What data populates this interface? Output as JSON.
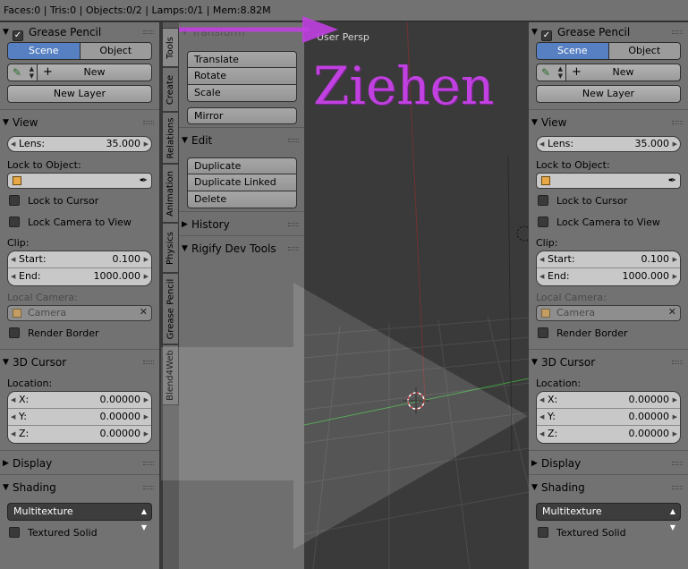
{
  "statusbar": {
    "text": "Faces:0 | Tris:0 | Objects:0/2 | Lamps:0/1 | Mem:8.82M"
  },
  "colors": {
    "accent": "#5680c2",
    "annotation": "#c040e0",
    "x_axis": "#c03030",
    "y_axis": "#40a040"
  },
  "properties": {
    "grease_pencil": {
      "title": "Grease Pencil",
      "scene": "Scene",
      "object": "Object",
      "new": "New",
      "new_layer": "New Layer"
    },
    "view": {
      "title": "View",
      "lens_label": "Lens:",
      "lens_value": "35.000",
      "lock_to_object": "Lock to Object:",
      "lock_to_cursor": "Lock to Cursor",
      "lock_camera": "Lock Camera to View",
      "clip": "Clip:",
      "start_label": "Start:",
      "start_value": "0.100",
      "end_label": "End:",
      "end_value": "1000.000",
      "local_camera": "Local Camera:",
      "camera": "Camera",
      "render_border": "Render Border"
    },
    "cursor": {
      "title": "3D Cursor",
      "location": "Location:",
      "x_label": "X:",
      "x_value": "0.00000",
      "y_label": "Y:",
      "y_value": "0.00000",
      "z_label": "Z:",
      "z_value": "0.00000"
    },
    "display": {
      "title": "Display"
    },
    "shading": {
      "title": "Shading",
      "mode": "Multitexture",
      "textured_solid": "Textured Solid"
    }
  },
  "tabs": [
    "Tools",
    "Create",
    "Relations",
    "Animation",
    "Physics",
    "Grease Pencil",
    "Blend4Web"
  ],
  "shelf": {
    "transform": "Transform",
    "translate": "Translate",
    "rotate": "Rotate",
    "scale": "Scale",
    "mirror": "Mirror",
    "edit": "Edit",
    "duplicate": "Duplicate",
    "duplicate_linked": "Duplicate Linked",
    "delete": "Delete",
    "history": "History",
    "rigify": "Rigify Dev Tools"
  },
  "viewport": {
    "title": "User Persp"
  },
  "annotation": {
    "text": "Ziehen"
  }
}
